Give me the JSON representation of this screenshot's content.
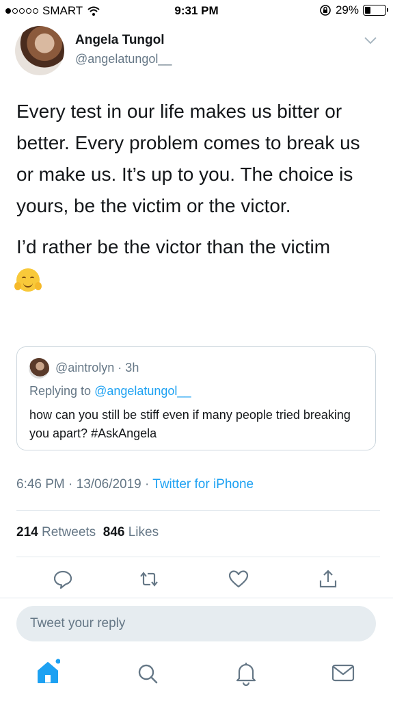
{
  "status_bar": {
    "carrier": "SMART",
    "time": "9:31 PM",
    "battery": "29%"
  },
  "tweet": {
    "author_name": "Angela Tungol",
    "author_handle": "@angelatungol__",
    "text_p1": "Every test in our life makes us bitter or better. Every problem comes to break us or make us. It’s up to you. The choice is yours, be the victim or the victor.",
    "text_p2": "I’d rather be the victor than the victim",
    "emoji": "hugging-face",
    "timestamp": "6:46 PM · 13/06/2019 · ",
    "client": "Twitter for iPhone",
    "retweets": "214",
    "retweets_label": "Retweets",
    "likes": "846",
    "likes_label": "Likes"
  },
  "quoted_tweet": {
    "handle_time": "@aintrolyn · 3h",
    "replying_prefix": "Replying to ",
    "replying_to": "@angelatungol__",
    "text": "how can you still be stiff even if many people tried breaking you apart? #AskAngela"
  },
  "reply_placeholder": "Tweet your reply",
  "colors": {
    "accent": "#1da1f2",
    "muted": "#657786",
    "text": "#14171a"
  },
  "icons": [
    "reply-icon",
    "retweet-icon",
    "like-icon",
    "share-icon",
    "home-icon",
    "search-icon",
    "notifications-icon",
    "messages-icon"
  ]
}
